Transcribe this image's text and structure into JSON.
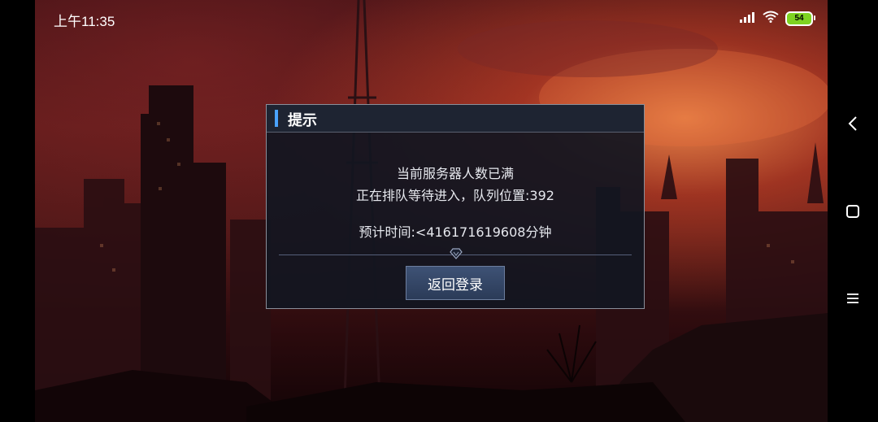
{
  "status_bar": {
    "time": "上午11:35",
    "battery_level": "54",
    "icons": [
      "signal-icon",
      "wifi-icon",
      "battery-icon"
    ]
  },
  "nav_bar": {
    "icons": [
      "back-icon",
      "home-icon",
      "menu-icon"
    ]
  },
  "dialog": {
    "title": "提示",
    "line1": "当前服务器人数已满",
    "line2": "正在排队等待进入，队列位置:392",
    "line3": "预计时间:<416171619608分钟",
    "button_label": "返回登录"
  },
  "colors": {
    "accent": "#4aa3ff",
    "battery": "#7ed321",
    "button": "#34476a"
  }
}
